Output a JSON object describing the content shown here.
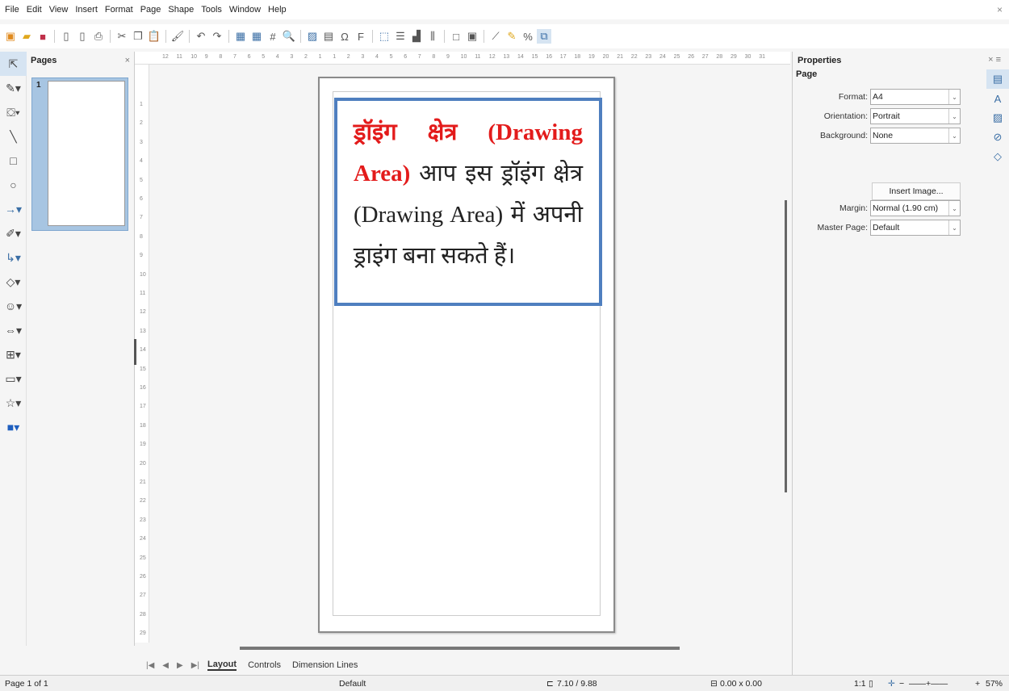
{
  "menu": [
    "File",
    "Edit",
    "View",
    "Insert",
    "Format",
    "Page",
    "Shape",
    "Tools",
    "Window",
    "Help"
  ],
  "pages_pane": {
    "title": "Pages",
    "close": "×",
    "thumb_number": "1"
  },
  "hruler_ticks": [
    "12",
    "11",
    "10",
    "9",
    "8",
    "7",
    "6",
    "5",
    "4",
    "3",
    "2",
    "1",
    "1",
    "2",
    "3",
    "4",
    "5",
    "6",
    "7",
    "8",
    "9",
    "10",
    "11",
    "12",
    "13",
    "14",
    "15",
    "16",
    "17",
    "18",
    "19",
    "20",
    "21",
    "22",
    "23",
    "24",
    "25",
    "26",
    "27",
    "28",
    "29",
    "30",
    "31"
  ],
  "vruler_ticks": [
    "1",
    "2",
    "3",
    "4",
    "5",
    "6",
    "7",
    "8",
    "9",
    "10",
    "11",
    "12",
    "13",
    "14",
    "15",
    "16",
    "17",
    "18",
    "19",
    "20",
    "21",
    "22",
    "23",
    "24",
    "25",
    "26",
    "27",
    "28",
    "29"
  ],
  "textbox": {
    "red_text": "ड्रॉइंग क्षेत्र (Drawing Area)",
    "body_text": " आप इस ड्रॉइंग क्षेत्र (Drawing Area) में अपनी ड्राइंग बना सकते हैं।"
  },
  "tabs": {
    "items": [
      "Layout",
      "Controls",
      "Dimension Lines"
    ],
    "active": "Layout"
  },
  "properties": {
    "title": "Properties",
    "section": "Page",
    "rows": [
      {
        "label": "Format:",
        "value": "A4"
      },
      {
        "label": "Orientation:",
        "value": "Portrait"
      },
      {
        "label": "Background:",
        "value": "None"
      },
      {
        "label": "Margin:",
        "value": "Normal (1.90 cm)"
      },
      {
        "label": "Master Page:",
        "value": "Default"
      }
    ],
    "insert_image": "Insert Image..."
  },
  "status": {
    "page": "Page 1 of 1",
    "master": "Default",
    "position": "7.10 / 9.88",
    "size": "0.00 x 0.00",
    "scale": "1:1",
    "zoom": "57%"
  }
}
